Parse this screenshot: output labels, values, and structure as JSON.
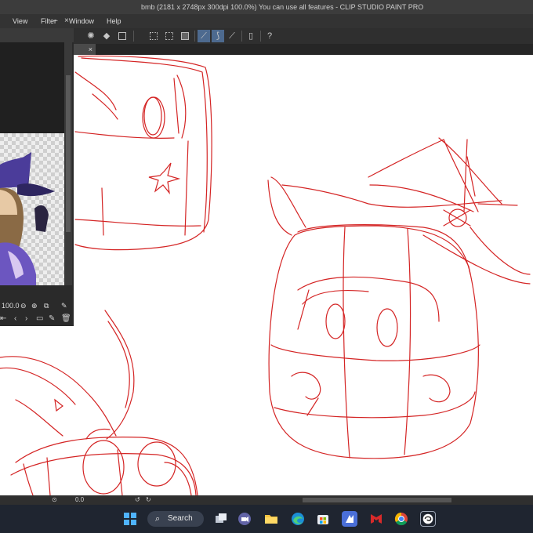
{
  "window": {
    "title": "bmb (2181 x 2748px 300dpi 100.0%)  You can use all features - CLIP STUDIO PAINT PRO"
  },
  "menu": {
    "items": [
      "View",
      "Filter",
      "Window",
      "Help"
    ]
  },
  "navigator": {
    "zoom_value": "100.0"
  },
  "statusbar": {
    "angle_value": "0.0"
  },
  "taskbar": {
    "search_label": "Search"
  },
  "icons": {
    "start": "windows-logo-icon",
    "search": "magnifier-icon",
    "taskview": "task-view-icon",
    "meet": "video-chat-icon",
    "explorer": "folder-icon",
    "edge": "edge-browser-icon",
    "store": "store-icon",
    "csp_app": "clip-studio-icon",
    "mcafee": "mcafee-icon",
    "chrome": "chrome-icon",
    "clipstudio": "clip-studio-paint-icon"
  },
  "colors": {
    "sketch_red": "#d42424",
    "accent_blue": "#4d6a8f",
    "taskbar": "#1f2530"
  }
}
